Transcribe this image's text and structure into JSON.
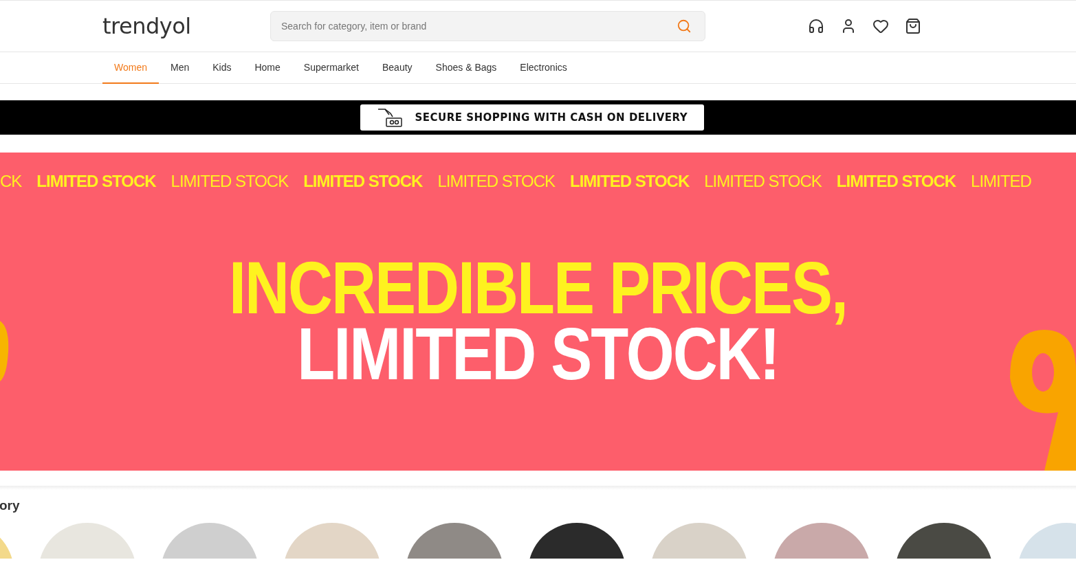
{
  "header": {
    "logo": "trendyol",
    "search": {
      "placeholder": "Search for category, item or brand"
    }
  },
  "nav": [
    {
      "label": "Women",
      "selected": true
    },
    {
      "label": "Men",
      "selected": false
    },
    {
      "label": "Kids",
      "selected": false
    },
    {
      "label": "Home",
      "selected": false
    },
    {
      "label": "Supermarket",
      "selected": false
    },
    {
      "label": "Beauty",
      "selected": false
    },
    {
      "label": "Shoes & Bags",
      "selected": false
    },
    {
      "label": "Electronics",
      "selected": false
    }
  ],
  "promo_strip": {
    "text": "SECURE SHOPPING WITH CASH ON DELIVERY"
  },
  "banner": {
    "ticker": [
      {
        "text": "CK",
        "kind": "light"
      },
      {
        "text": "LIMITED STOCK",
        "kind": "bold"
      },
      {
        "text": "LIMITED STOCK",
        "kind": "light"
      },
      {
        "text": "LIMITED STOCK",
        "kind": "bold"
      },
      {
        "text": "LIMITED STOCK",
        "kind": "light"
      },
      {
        "text": "LIMITED STOCK",
        "kind": "bold"
      },
      {
        "text": "LIMITED STOCK",
        "kind": "light"
      },
      {
        "text": "LIMITED STOCK",
        "kind": "bold"
      },
      {
        "text": "LIMITED",
        "kind": "light"
      }
    ],
    "headline": [
      "INCREDIBLE PRICES,",
      "LIMITED STOCK!"
    ]
  },
  "category_section": {
    "title": "ory"
  }
}
